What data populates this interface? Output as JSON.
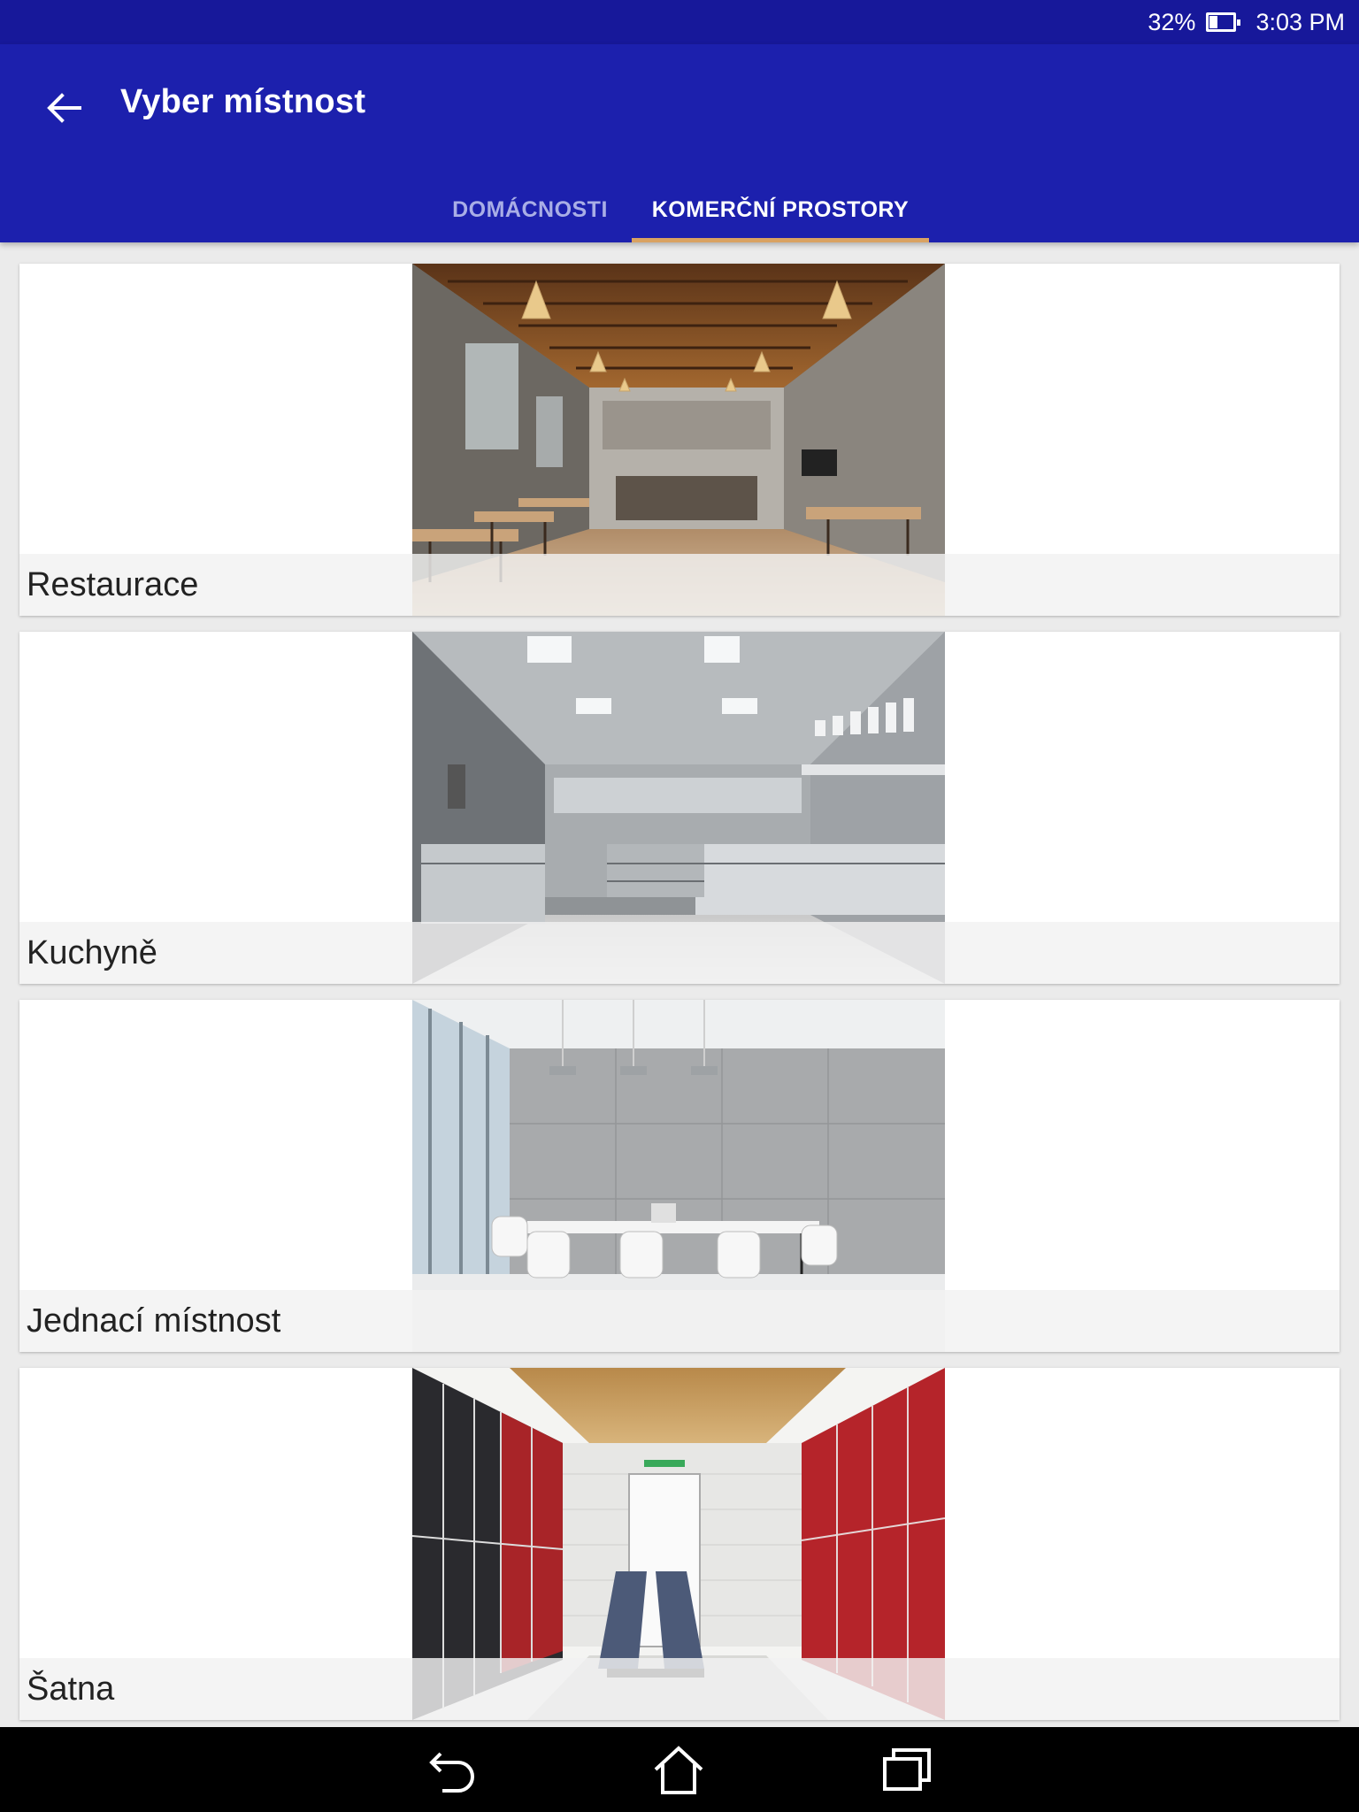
{
  "status_bar": {
    "battery_percent": "32%",
    "time": "3:03 PM",
    "icons": [
      "battery-icon"
    ]
  },
  "app_bar": {
    "title": "Vyber místnost",
    "back_icon": "arrow-left-icon",
    "background_color": "#1c20ad"
  },
  "tabs": [
    {
      "label": "DOMÁCNOSTI",
      "selected": false
    },
    {
      "label": "KOMERČNÍ PROSTORY",
      "selected": true
    }
  ],
  "accent_color": "#d9a262",
  "rooms": [
    {
      "label": "Restaurace",
      "image": "restaurant-photo"
    },
    {
      "label": "Kuchyně",
      "image": "commercial-kitchen-photo"
    },
    {
      "label": "Jednací místnost",
      "image": "meeting-room-photo"
    },
    {
      "label": "Šatna",
      "image": "locker-room-photo"
    }
  ],
  "nav_bar": {
    "buttons": [
      "back-icon",
      "home-icon",
      "recents-icon"
    ]
  }
}
